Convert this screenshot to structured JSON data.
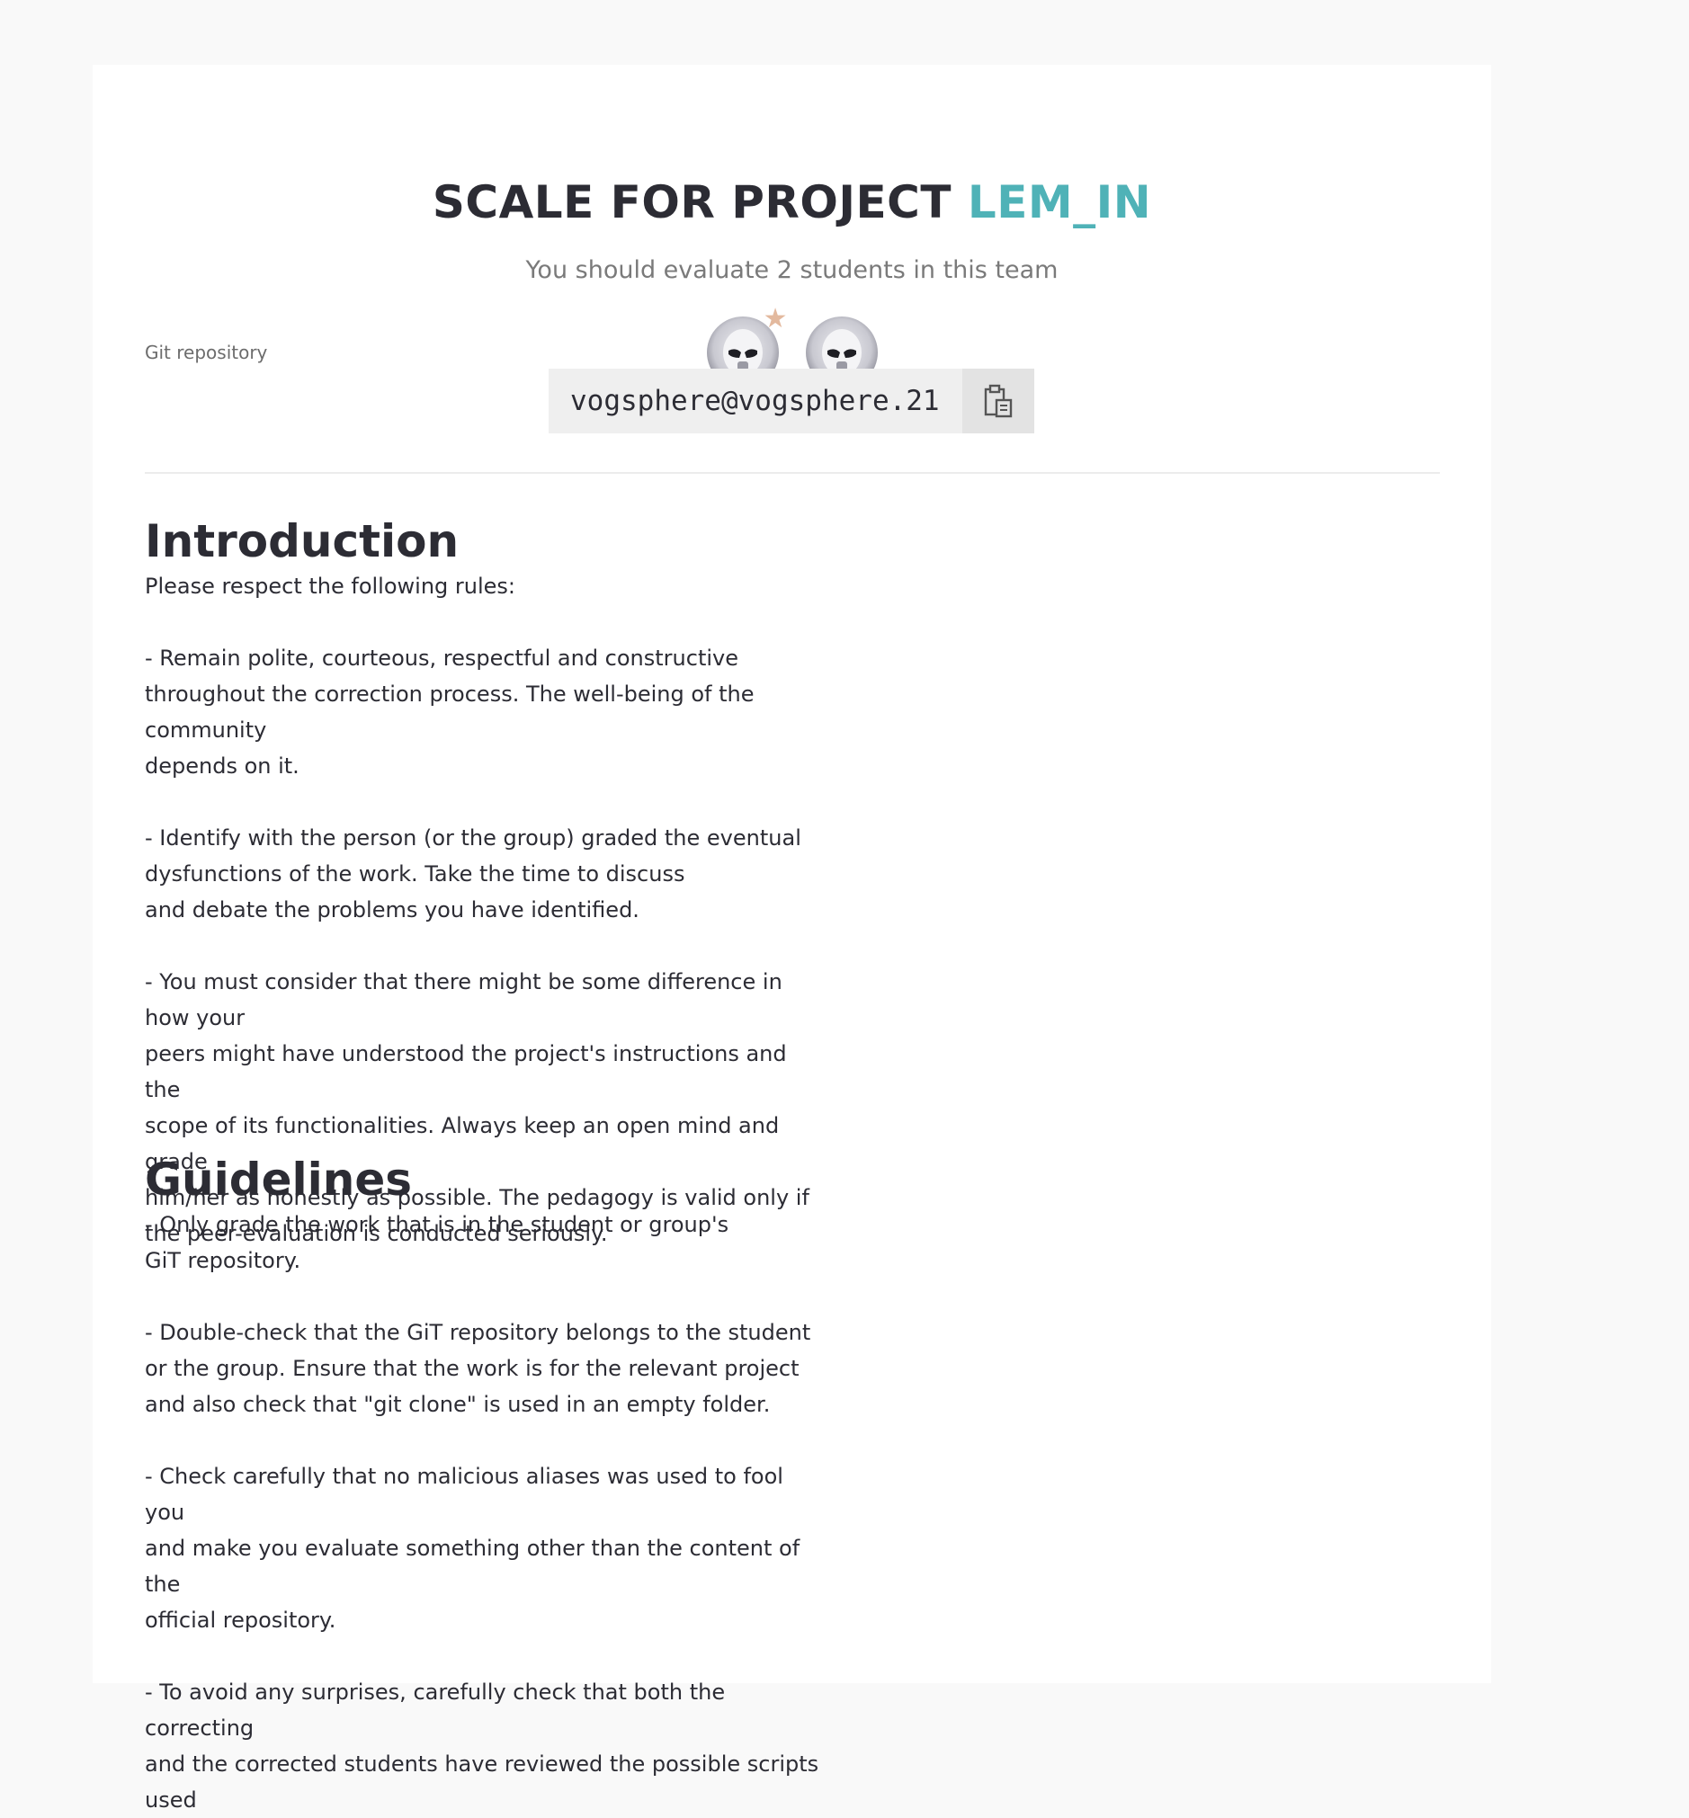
{
  "header": {
    "title_prefix": "SCALE FOR PROJECT",
    "project_name": "LEM_IN",
    "subtitle": "You should evaluate 2 students in this team"
  },
  "team": {
    "avatars": [
      {
        "icon": "stormtrooper-avatar",
        "leader": true
      },
      {
        "icon": "stormtrooper-avatar",
        "leader": false
      }
    ],
    "leader_icon": "star-icon",
    "accent_color": "#e3b99e"
  },
  "repository": {
    "label": "Git repository",
    "value": "vogsphere@vogsphere.21",
    "copy_icon": "clipboard-icon"
  },
  "introduction": {
    "heading": "Introduction",
    "body": "Please respect the following rules:\n\n- Remain polite, courteous, respectful and constructive\nthroughout the correction process. The well-being of the community\ndepends on it.\n\n- Identify with the person (or the group) graded the eventual\ndysfunctions of the work. Take the time to discuss\nand debate the problems you have identified.\n\n- You must consider that there might be some difference in how your\npeers might have understood the project's instructions and the\nscope of its functionalities. Always keep an open mind and grade\nhim/her as honestly as possible. The pedagogy is valid only if\nthe peer-evaluation is conducted seriously."
  },
  "guidelines": {
    "heading": "Guidelines",
    "body": "- Only grade the work that is in the student or group's\nGiT repository.\n\n- Double-check that the GiT repository belongs to the student\nor the group. Ensure that the work is for the relevant project\nand also check that \"git clone\" is used in an empty folder.\n\n- Check carefully that no malicious aliases was used to fool you\nand make you evaluate something other than the content of the\nofficial repository.\n\n- To avoid any surprises, carefully check that both the correcting\nand the corrected students have reviewed the possible scripts used"
  },
  "colors": {
    "accent": "#4fb2b7",
    "text": "#2c2c34",
    "background": "#f9f9f9"
  }
}
